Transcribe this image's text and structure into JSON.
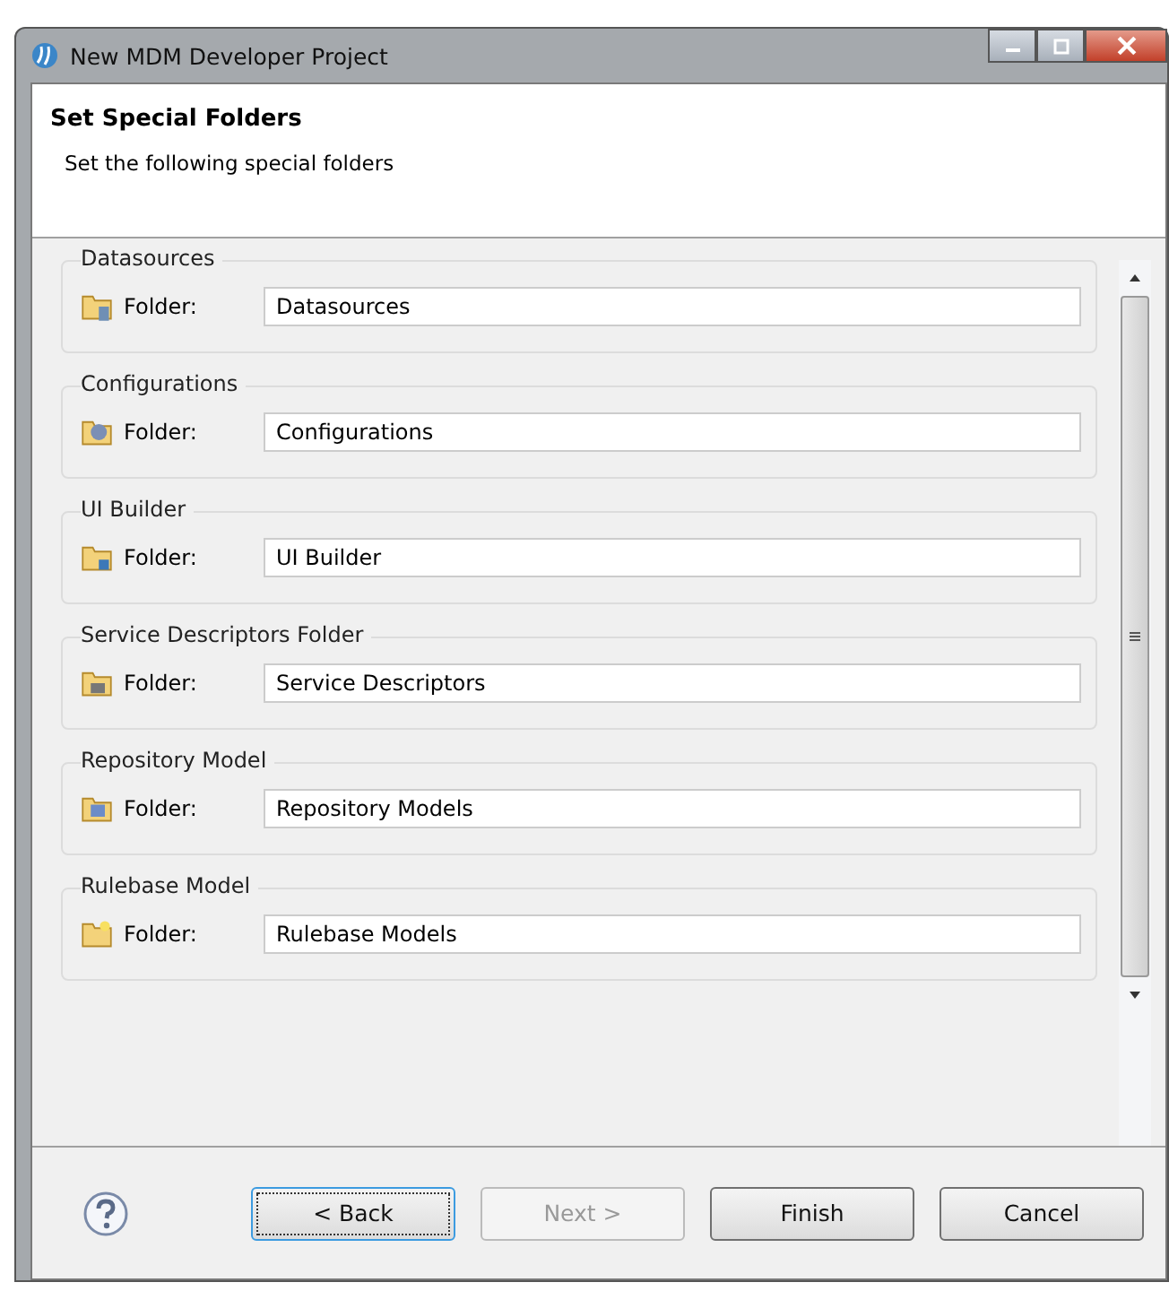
{
  "window": {
    "title": "New MDM Developer Project"
  },
  "header": {
    "title": "Set Special Folders",
    "description": "Set the following special folders"
  },
  "folders": [
    {
      "kind": "datasource",
      "group": "Datasources",
      "label": "Folder:",
      "value": "Datasources"
    },
    {
      "kind": "config",
      "group": "Configurations",
      "label": "Folder:",
      "value": "Configurations"
    },
    {
      "kind": "ui",
      "group": "UI Builder",
      "label": "Folder:",
      "value": "UI Builder"
    },
    {
      "kind": "service",
      "group": "Service Descriptors Folder",
      "label": "Folder:",
      "value": "Service Descriptors"
    },
    {
      "kind": "repository",
      "group": "Repository Model",
      "label": "Folder:",
      "value": "Repository Models"
    },
    {
      "kind": "rulebase",
      "group": "Rulebase Model",
      "label": "Folder:",
      "value": "Rulebase Models"
    }
  ],
  "buttons": [
    {
      "label": "< Back",
      "disabled": false,
      "focused": true
    },
    {
      "label": "Next >",
      "disabled": true,
      "focused": false
    },
    {
      "label": "Finish",
      "disabled": false,
      "focused": false
    },
    {
      "label": "Cancel",
      "disabled": false,
      "focused": false
    }
  ]
}
